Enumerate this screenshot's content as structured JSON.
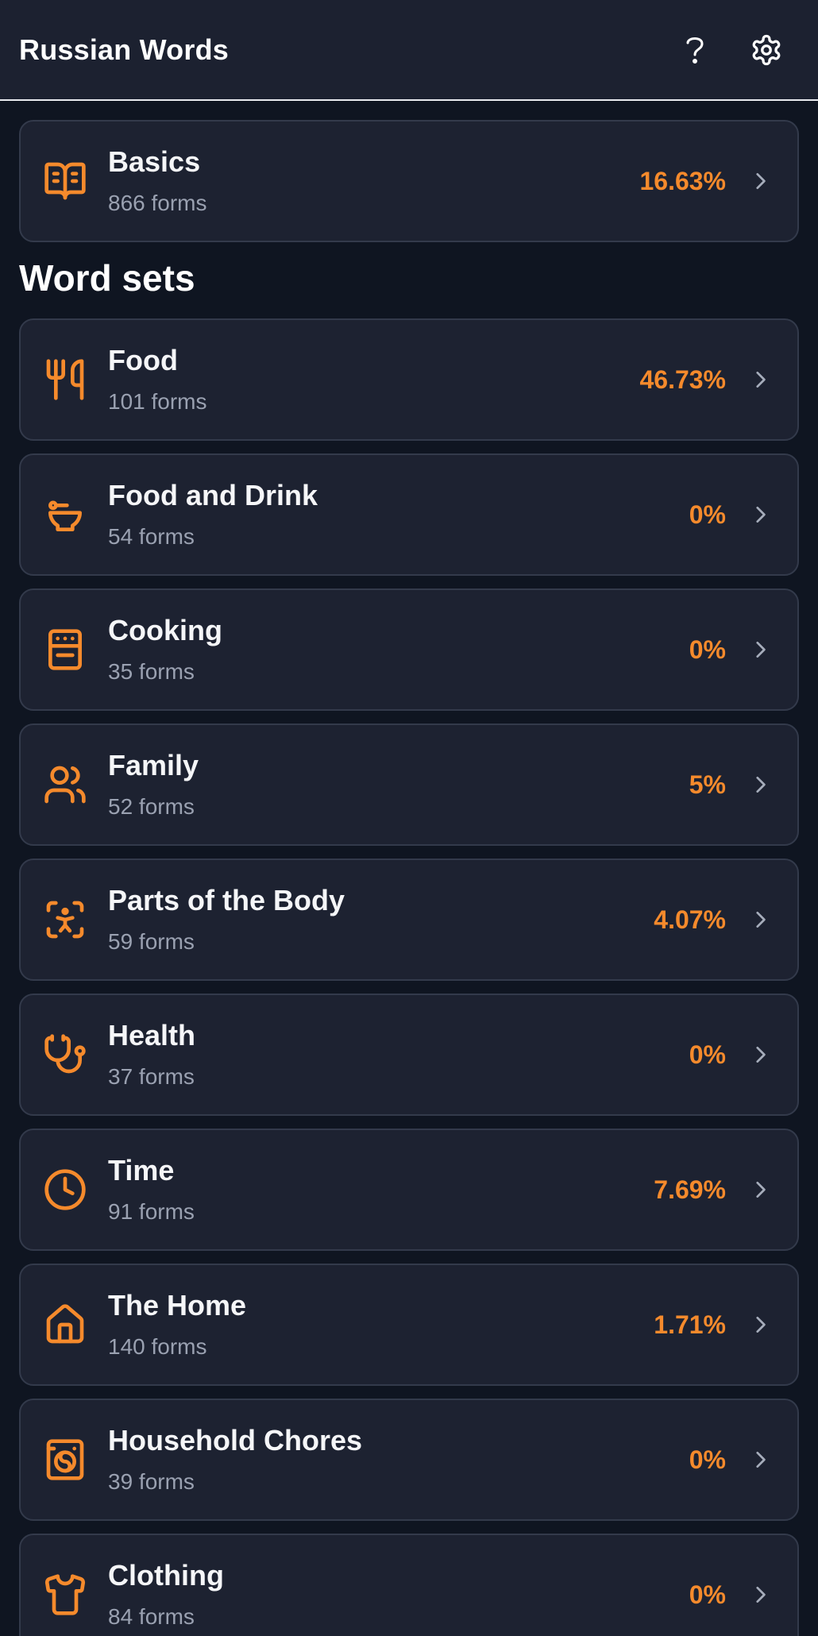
{
  "header": {
    "title": "Russian Words",
    "help_icon": "question-mark-icon",
    "settings_icon": "gear-icon"
  },
  "colors": {
    "accent": "#f58a2c",
    "background": "#0f1521",
    "card": "#1d2231",
    "subtext": "#9aa1b1"
  },
  "basics": {
    "title": "Basics",
    "forms": "866 forms",
    "percent": "16.63%",
    "icon": "book-open-icon"
  },
  "section_title": "Word sets",
  "word_sets": [
    {
      "title": "Food",
      "forms": "101 forms",
      "percent": "46.73%",
      "icon": "utensils-icon"
    },
    {
      "title": "Food and Drink",
      "forms": "54 forms",
      "percent": "0%",
      "icon": "bowl-icon"
    },
    {
      "title": "Cooking",
      "forms": "35 forms",
      "percent": "0%",
      "icon": "oven-icon"
    },
    {
      "title": "Family",
      "forms": "52 forms",
      "percent": "5%",
      "icon": "users-icon"
    },
    {
      "title": "Parts of the Body",
      "forms": "59 forms",
      "percent": "4.07%",
      "icon": "body-scan-icon"
    },
    {
      "title": "Health",
      "forms": "37 forms",
      "percent": "0%",
      "icon": "stethoscope-icon"
    },
    {
      "title": "Time",
      "forms": "91 forms",
      "percent": "7.69%",
      "icon": "clock-icon"
    },
    {
      "title": "The Home",
      "forms": "140 forms",
      "percent": "1.71%",
      "icon": "house-icon"
    },
    {
      "title": "Household Chores",
      "forms": "39 forms",
      "percent": "0%",
      "icon": "washing-machine-icon"
    },
    {
      "title": "Clothing",
      "forms": "84 forms",
      "percent": "0%",
      "icon": "shirt-icon"
    }
  ]
}
